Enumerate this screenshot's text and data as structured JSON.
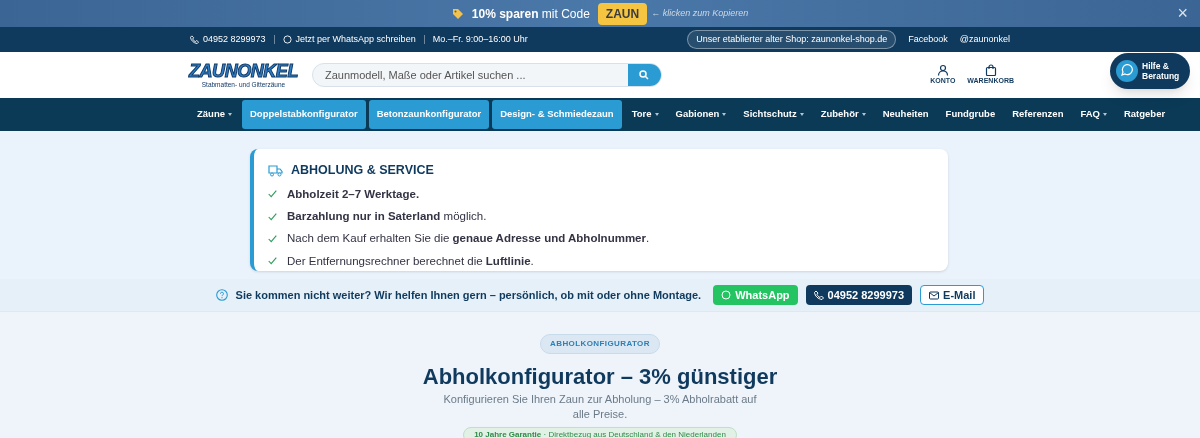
{
  "promo": {
    "text": "**10% sparen** mit Code",
    "code": "ZAUN",
    "hint": "← klicken zum Kopieren",
    "close": "×"
  },
  "topbar": {
    "phone": "04952 8299973",
    "whatsapp": "Jetzt per WhatsApp schreiben",
    "hours": "Mo.–Fr. 9:00–16:00 Uhr",
    "old_shop": "Unser etablierter alter Shop: zaunonkel-shop.de",
    "facebook": "Facebook",
    "instagram": "@zaunonkel"
  },
  "header": {
    "logo": "ZAUNONKEL",
    "tagline": "Stabmatten- und Gitterzäune",
    "search_placeholder": "Zaunmodell, Maße oder Artikel suchen ...",
    "account": "KONTO",
    "cart": "WARENKORB",
    "help": "Hilfe & Beratung"
  },
  "nav": [
    {
      "label": "Zäune",
      "kind": "link",
      "dropdown": true
    },
    {
      "label": "Doppelstabkonfigurator",
      "kind": "button",
      "dropdown": false
    },
    {
      "label": "Betonzaunkonfigurator",
      "kind": "button",
      "dropdown": false
    },
    {
      "label": "Design- & Schmiedezaun",
      "kind": "button",
      "dropdown": false
    },
    {
      "label": "Tore",
      "kind": "link",
      "dropdown": true
    },
    {
      "label": "Gabionen",
      "kind": "link",
      "dropdown": true
    },
    {
      "label": "Sichtschutz",
      "kind": "link",
      "dropdown": true
    },
    {
      "label": "Zubehör",
      "kind": "link",
      "dropdown": true
    },
    {
      "label": "Neuheiten",
      "kind": "link",
      "dropdown": false
    },
    {
      "label": "Fundgrube",
      "kind": "link",
      "dropdown": false
    },
    {
      "label": "Referenzen",
      "kind": "link",
      "dropdown": false
    },
    {
      "label": "FAQ",
      "kind": "link",
      "dropdown": true
    },
    {
      "label": "Ratgeber",
      "kind": "link",
      "dropdown": false
    }
  ],
  "service": {
    "title": "ABHOLUNG & SERVICE",
    "items": [
      "**Abholzeit 2–7 Werktage.**",
      "**Barzahlung nur in Saterland** möglich.",
      "Nach dem Kauf erhalten Sie die **genaue Adresse und Abholnummer**.",
      "Der Entfernungsrechner berechnet die **Luftlinie**."
    ]
  },
  "help_bar": {
    "text": "Sie kommen nicht weiter? Wir helfen Ihnen gern – persönlich, ob mit oder ohne Montage.",
    "whatsapp": "WhatsApp",
    "phone": "04952 8299973",
    "email": "E-Mail"
  },
  "hero": {
    "badge": "ABHOLKONFIGURATOR",
    "title": "Abholkonfigurator – 3% günstiger",
    "subtitle": "Konfigurieren Sie Ihren Zaun zur Abholung – 3% Abholrabatt auf alle Preise.",
    "guarantee": "**10 Jahre Garantie** · Direktbezug aus Deutschland & den Niederlanden"
  }
}
